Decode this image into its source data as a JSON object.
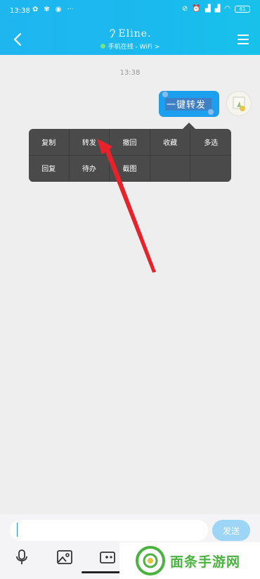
{
  "status_bar": {
    "time": "13:38",
    "more": "···",
    "battery": "61"
  },
  "header": {
    "title": "Eline.",
    "status": "手机在线 - WiFi",
    "chevron": ">"
  },
  "chat": {
    "timestamp": "13:38",
    "message": "一键转发"
  },
  "context_menu": {
    "items": [
      "复制",
      "转发",
      "撤回",
      "收藏",
      "多选",
      "回复",
      "待办",
      "截图",
      "",
      ""
    ]
  },
  "input": {
    "value": "",
    "placeholder": "",
    "send_label": "发送"
  },
  "icons": {
    "back": "chevron-left-icon",
    "menu": "hamburger-icon",
    "mic": "microphone-icon",
    "image": "image-icon",
    "camera": "camera-icon"
  },
  "watermark": {
    "text": "面条手游网"
  },
  "colors": {
    "header": "#1fb6f0",
    "bubble": "#1aa0ee",
    "menu": "#4a4a4a",
    "arrow": "#e8222b",
    "send": "#9dd5f6",
    "watermark": "#4ab33f"
  }
}
